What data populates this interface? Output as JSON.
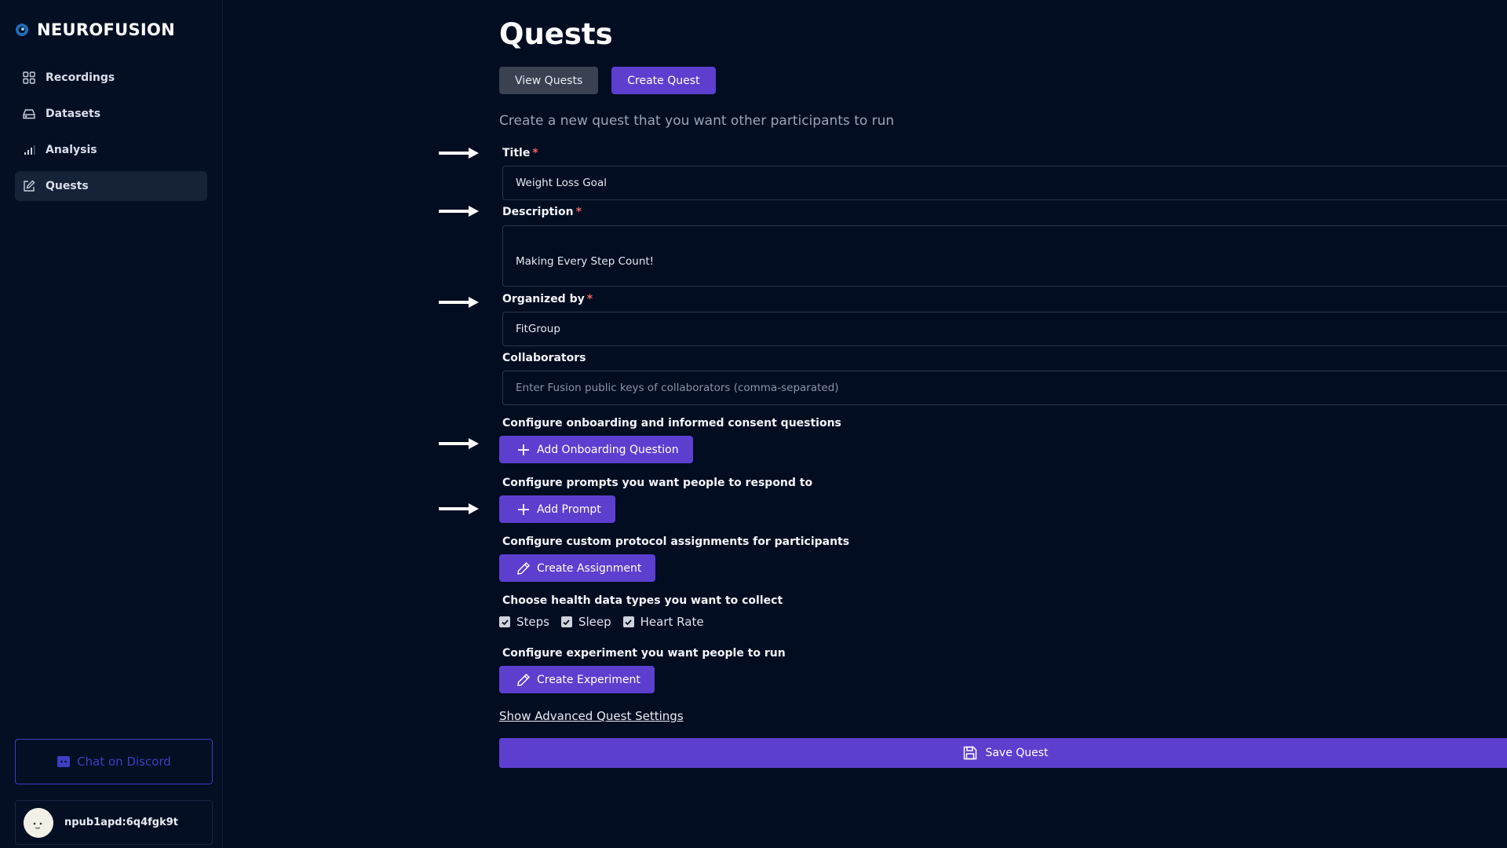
{
  "app": {
    "name": "NEUROFUSION"
  },
  "sidebar": {
    "items": [
      {
        "label": "Recordings",
        "icon": "grid-icon",
        "active": false
      },
      {
        "label": "Datasets",
        "icon": "drive-icon",
        "active": false
      },
      {
        "label": "Analysis",
        "icon": "bar-chart-icon",
        "active": false
      },
      {
        "label": "Quests",
        "icon": "edit-icon",
        "active": true
      }
    ],
    "discord_label": "Chat on Discord",
    "user_name": "npub1apd:6q4fgk9t"
  },
  "page": {
    "title": "Quests",
    "tabs": [
      {
        "label": "View Quests",
        "active": false
      },
      {
        "label": "Create Quest",
        "active": true
      }
    ],
    "subtitle": "Create a new quest that you want other participants to run"
  },
  "form": {
    "title": {
      "label": "Title",
      "required_mark": "*",
      "value": "Weight Loss Goal"
    },
    "description": {
      "label": "Description",
      "required_mark": "*",
      "value": "Making Every Step Count!"
    },
    "organized_by": {
      "label": "Organized by",
      "required_mark": "*",
      "value": "FitGroup"
    },
    "collaborators": {
      "label": "Collaborators",
      "value": "",
      "placeholder": "Enter Fusion public keys of collaborators (comma-separated)"
    },
    "onboarding": {
      "label": "Configure onboarding and informed consent questions",
      "button": "Add Onboarding Question"
    },
    "prompts": {
      "label": "Configure prompts you want people to respond to",
      "button": "Add Prompt"
    },
    "assignments": {
      "label": "Configure custom protocol assignments for participants",
      "button": "Create Assignment"
    },
    "health": {
      "label": "Choose health data types you want to collect",
      "options": [
        {
          "label": "Steps",
          "checked": true
        },
        {
          "label": "Sleep",
          "checked": true
        },
        {
          "label": "Heart Rate",
          "checked": true
        }
      ]
    },
    "experiment": {
      "label": "Configure experiment you want people to run",
      "button": "Create Experiment"
    },
    "advanced_link": "Show Advanced Quest Settings",
    "save_label": "Save Quest"
  },
  "colors": {
    "background": "#030d21",
    "accent": "#5d3fcf",
    "discord": "#3e3fc2",
    "required": "#f06262"
  }
}
